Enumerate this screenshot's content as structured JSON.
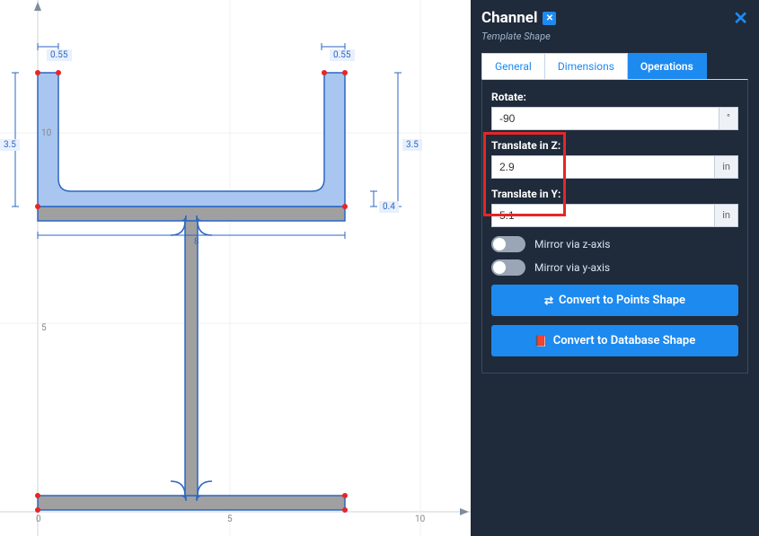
{
  "panel": {
    "title": "Channel",
    "subtitle": "Template Shape",
    "tabs": {
      "general": "General",
      "dimensions": "Dimensions",
      "operations": "Operations"
    }
  },
  "fields": {
    "rotate_label": "Rotate:",
    "rotate_value": "-90",
    "rotate_unit": "°",
    "tz_label": "Translate in Z:",
    "tz_value": "2.9",
    "tz_unit": "in",
    "ty_label": "Translate in Y:",
    "ty_value": "5.1",
    "ty_unit": "in"
  },
  "toggles": {
    "mirror_z": "Mirror via z-axis",
    "mirror_y": "Mirror via y-axis"
  },
  "buttons": {
    "to_points": "Convert to Points Shape",
    "to_db": "Convert to Database Shape"
  },
  "dims": {
    "tl_flange_w": "0.55",
    "tr_flange_w": "0.55",
    "left_depth": "3.5",
    "right_depth": "3.5",
    "web_n": "0.4",
    "axis10": "10",
    "axis5": "5",
    "x0": "0",
    "x5": "5",
    "x10": "10",
    "axis8": "8"
  },
  "chart_data": {
    "type": "diagram",
    "description": "Composite steel section: wide-flange I-beam with U-channel placed on top, rotated -90°",
    "xlim": [
      0,
      11
    ],
    "ylim": [
      0,
      11
    ],
    "ibeam": {
      "bf": 8,
      "d": 10,
      "tf": 0.4,
      "tw": 0.3,
      "origin": [
        1,
        0
      ]
    },
    "channel": {
      "bf": 3.5,
      "d": 8,
      "tf": 0.55,
      "tw": 0.4,
      "rotate": -90,
      "translate_z": 2.9,
      "translate_y": 5.1
    },
    "dimension_callouts": [
      {
        "label": "0.55",
        "for": "channel top-left flange width"
      },
      {
        "label": "0.55",
        "for": "channel top-right flange width"
      },
      {
        "label": "3.5",
        "for": "channel left flange height"
      },
      {
        "label": "3.5",
        "for": "channel right flange height"
      },
      {
        "label": "0.4",
        "for": "channel web thickness"
      },
      {
        "label": "8",
        "for": "ibeam flange width"
      }
    ],
    "x_ticks": [
      0,
      5,
      10
    ],
    "y_ticks": [
      5,
      10
    ]
  }
}
